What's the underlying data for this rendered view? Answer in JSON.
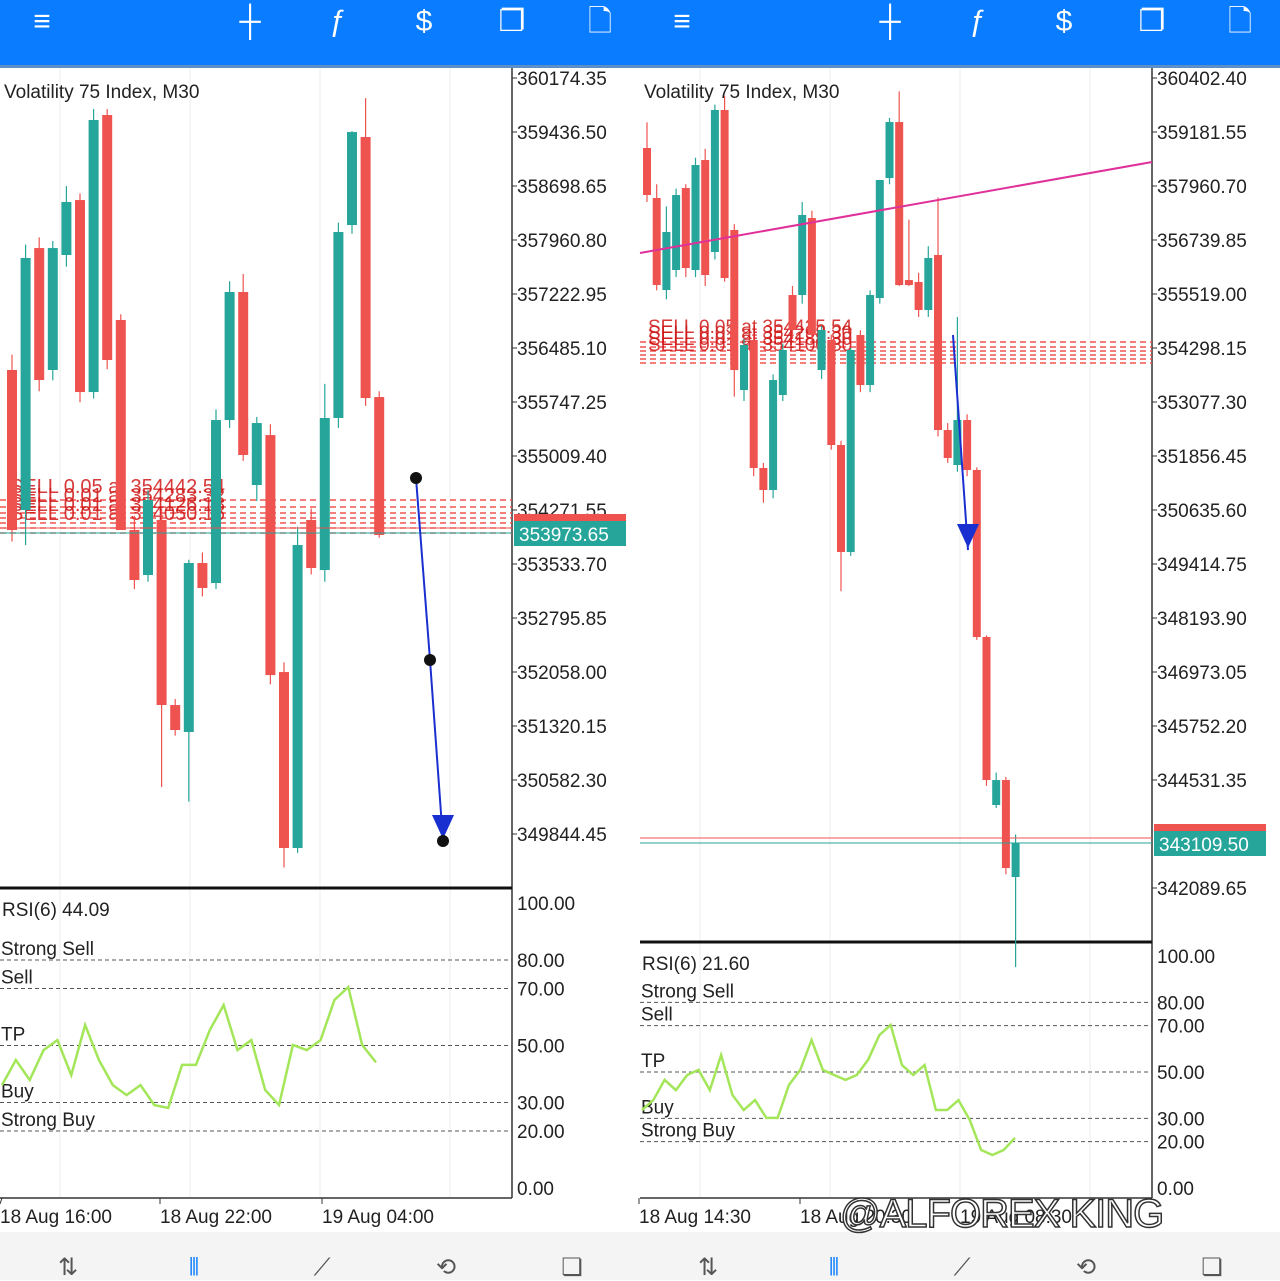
{
  "toolbar": {
    "icons": [
      "menu-icon",
      "crosshair-icon",
      "indicators-icon",
      "trade-icon",
      "windows-icon",
      "new-order-icon"
    ],
    "symbols": [
      "≡",
      "┼",
      "ƒ",
      "$",
      "❐",
      "🗋"
    ]
  },
  "nav": {
    "icons": [
      "quotes-icon",
      "chart-icon",
      "trade-icon",
      "history-icon",
      "messages-icon"
    ],
    "symbols": [
      "⇅",
      "⫴",
      "⟋",
      "⟲",
      "❏"
    ],
    "active_color": "#0a7cff"
  },
  "watermark": "@ALFOREX KING",
  "colors": {
    "bull": "#26a69a",
    "bear": "#ef5350",
    "rsi": "#a4e65a",
    "trend": "#e0309a",
    "arrow": "#1a2fd0"
  },
  "panels": [
    {
      "title": "Volatility 75 Index, M30",
      "price_labels": [
        "360174.35",
        "359436.50",
        "358698.65",
        "357960.80",
        "357222.95",
        "356485.10",
        "355747.25",
        "355009.40",
        "354271.55",
        "353533.70",
        "352795.85",
        "352058.00",
        "351320.15",
        "350582.30",
        "349844.45"
      ],
      "current_price": "353973.65",
      "order_labels": [
        "SELL 0.05 at 354442.54",
        "SELL 0.01 at 354283.32",
        "SELL 0.01 at 354126.18",
        "SELL 0.01 at 354050.16"
      ],
      "candles": [
        [
          356190,
          356400,
          353850,
          354006
        ],
        [
          354279,
          357900,
          353800,
          357718
        ],
        [
          357854,
          358000,
          355900,
          356053
        ],
        [
          356190,
          357950,
          356050,
          357854
        ],
        [
          357759,
          358700,
          357600,
          358482
        ],
        [
          358509,
          358600,
          355750,
          355889
        ],
        [
          355889,
          359750,
          355800,
          359601
        ],
        [
          359669,
          359750,
          356200,
          356326
        ],
        [
          356872,
          356950,
          354006,
          354006
        ],
        [
          354006,
          354200,
          353200,
          353324
        ],
        [
          353392,
          354550,
          353300,
          354415
        ],
        [
          354143,
          354300,
          350500,
          351618
        ],
        [
          351618,
          351700,
          351200,
          351277
        ],
        [
          351250,
          353600,
          350300,
          353556
        ],
        [
          353556,
          353700,
          353100,
          353215
        ],
        [
          353283,
          355650,
          353200,
          355507
        ],
        [
          355507,
          357400,
          355400,
          357254
        ],
        [
          357254,
          357500,
          354950,
          355030
        ],
        [
          354620,
          355550,
          354400,
          355466
        ],
        [
          355302,
          355450,
          351900,
          352027
        ],
        [
          352068,
          352200,
          349400,
          349667
        ],
        [
          349667,
          354050,
          349600,
          353801
        ],
        [
          354143,
          354300,
          353400,
          353488
        ],
        [
          353460,
          356000,
          353300,
          355535
        ],
        [
          355535,
          358200,
          355400,
          358073
        ],
        [
          358168,
          359450,
          358050,
          359437
        ],
        [
          359369,
          359900,
          355700,
          355807
        ],
        [
          355821,
          355900,
          353900,
          353938
        ]
      ],
      "rsi": {
        "label": "RSI(6) 44.09",
        "axis": [
          "100.00",
          "80.00",
          "70.00",
          "50.00",
          "30.00",
          "20.00",
          "0.00"
        ],
        "levels": [
          {
            "v": 80,
            "name": "Strong Sell"
          },
          {
            "v": 70,
            "name": "Sell"
          },
          {
            "v": 50,
            "name": "TP"
          },
          {
            "v": 30,
            "name": "Buy"
          },
          {
            "v": 20,
            "name": "Strong Buy"
          }
        ],
        "values": [
          36.1,
          44.9,
          37.9,
          48.4,
          51.9,
          39.6,
          57.2,
          44.9,
          36.1,
          32.6,
          36.1,
          29.1,
          28.1,
          43.2,
          43.2,
          55.4,
          64.2,
          48.4,
          51.9,
          34.4,
          29.1,
          50.2,
          48.4,
          51.9,
          66.0,
          70.5,
          50.2,
          44.09
        ]
      },
      "arrow": [
        354716,
        352232,
        349762
      ],
      "time_labels": [
        "18 Aug 16:00",
        "18 Aug 22:00",
        "19 Aug 04:00"
      ]
    },
    {
      "title": "Volatility 75 Index, M30",
      "price_labels": [
        "360402.40",
        "359181.55",
        "357960.70",
        "356739.85",
        "355519.00",
        "354298.15",
        "353077.30",
        "351856.45",
        "350635.60",
        "349414.75",
        "348193.90",
        "346973.05",
        "345752.20",
        "344531.35",
        "342089.65"
      ],
      "current_price": "343109.50",
      "order_labels": [
        "SELL 0.05 at 354425.54",
        "SELL 0.01 at 354298.30",
        "SELL 0.01 at 354188.30",
        "SELL 0.01 at 354100.30"
      ],
      "candles": [
        [
          358820,
          359400,
          357600,
          357757
        ],
        [
          357689,
          358000,
          355600,
          355722
        ],
        [
          355609,
          357500,
          355400,
          356921
        ],
        [
          356061,
          357900,
          355900,
          357757
        ],
        [
          357915,
          358000,
          355900,
          356106
        ],
        [
          356061,
          358600,
          355900,
          358435
        ],
        [
          358548,
          358800,
          355700,
          355948
        ],
        [
          356469,
          359800,
          356300,
          359679
        ],
        [
          359679,
          360000,
          355800,
          355880
        ],
        [
          356966,
          357100,
          353200,
          353800
        ],
        [
          353348,
          354500,
          353100,
          354366
        ],
        [
          354479,
          354600,
          351400,
          351585
        ],
        [
          351585,
          351700,
          350800,
          351088
        ],
        [
          351088,
          353700,
          350900,
          353574
        ],
        [
          353235,
          354400,
          353100,
          354253
        ],
        [
          355496,
          355700,
          354500,
          354705
        ],
        [
          355496,
          357600,
          355300,
          357305
        ],
        [
          357237,
          357400,
          354400,
          354592
        ],
        [
          353800,
          354800,
          353600,
          354705
        ],
        [
          354479,
          354600,
          352000,
          352105
        ],
        [
          352105,
          352200,
          348800,
          349686
        ],
        [
          349686,
          354300,
          349600,
          354253
        ],
        [
          354592,
          354700,
          353300,
          353461
        ],
        [
          353461,
          355600,
          353300,
          355496
        ],
        [
          355428,
          358100,
          355300,
          358096
        ],
        [
          358141,
          359500,
          358000,
          359407
        ],
        [
          359407,
          360100,
          355700,
          355722
        ],
        [
          355835,
          357200,
          355700,
          355722
        ],
        [
          355790,
          356000,
          355000,
          355157
        ],
        [
          355157,
          356600,
          355000,
          356333
        ],
        [
          356401,
          357700,
          352300,
          352444
        ],
        [
          352444,
          352600,
          351700,
          351811
        ],
        [
          351653,
          355000,
          351500,
          352670
        ],
        [
          352670,
          352800,
          351400,
          351540
        ],
        [
          351540,
          351600,
          347700,
          347764
        ],
        [
          347764,
          347800,
          344400,
          344531
        ],
        [
          343966,
          344700,
          343900,
          344531
        ],
        [
          344531,
          344600,
          342400,
          342541
        ],
        [
          342338,
          343300,
          340300,
          343107
        ]
      ],
      "rsi": {
        "label": "RSI(6) 21.60",
        "axis": [
          "100.00",
          "80.00",
          "70.00",
          "50.00",
          "30.00",
          "20.00",
          "0.00"
        ],
        "levels": [
          {
            "v": 80,
            "name": "Strong Sell"
          },
          {
            "v": 70,
            "name": "Sell"
          },
          {
            "v": 50,
            "name": "TP"
          },
          {
            "v": 30,
            "name": "Buy"
          },
          {
            "v": 20,
            "name": "Strong Buy"
          }
        ],
        "values": [
          33.6,
          37.9,
          46.6,
          42.2,
          48.7,
          50.9,
          42.2,
          57.3,
          40.1,
          33.6,
          37.9,
          30.2,
          30.2,
          44.4,
          50.9,
          63.8,
          50.9,
          48.7,
          46.6,
          48.7,
          55.2,
          65.9,
          70.3,
          53.0,
          48.7,
          53.0,
          33.6,
          33.6,
          37.9,
          29.3,
          16.4,
          14.2,
          16.4,
          21.6
        ]
      },
      "arrow": [
        354592,
        349731
      ],
      "trendline": [
        356446,
        358503
      ],
      "time_labels": [
        "18 Aug 14:30",
        "18 Aug 20:30",
        "19 Aug 08:30"
      ]
    }
  ]
}
